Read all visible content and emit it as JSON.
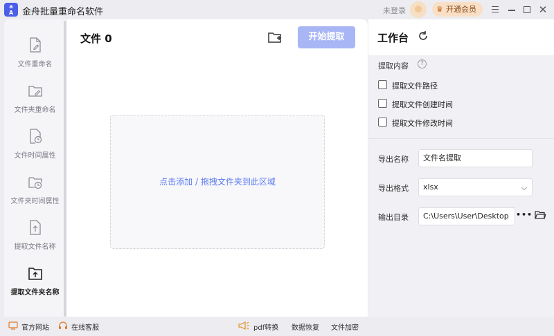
{
  "app": {
    "title": "金舟批量重命名软件",
    "logo_text": "A",
    "login_text": "未登录",
    "vip_label": "开通会员"
  },
  "sidebar": {
    "items": [
      {
        "label": "文件重命名",
        "icon": "file-edit-icon"
      },
      {
        "label": "文件夹重命名",
        "icon": "folder-edit-icon"
      },
      {
        "label": "文件时间属性",
        "icon": "file-clock-icon"
      },
      {
        "label": "文件夹时间属性",
        "icon": "folder-clock-icon"
      },
      {
        "label": "提取文件名称",
        "icon": "file-upload-icon"
      },
      {
        "label": "提取文件夹名称",
        "icon": "folder-upload-icon",
        "active": true
      }
    ]
  },
  "main": {
    "title": "文件 0",
    "extract_button": "开始提取",
    "dropzone": {
      "add_text": "点击添加",
      "separator": " / ",
      "drag_text": "拖拽文件夹到此区域"
    }
  },
  "workspace": {
    "title": "工作台",
    "content_label": "提取内容",
    "options": [
      {
        "label": "提取文件路径",
        "checked": false
      },
      {
        "label": "提取文件创建时间",
        "checked": false
      },
      {
        "label": "提取文件修改时间",
        "checked": false
      }
    ],
    "export_name_label": "导出名称",
    "export_name_value": "文件名提取",
    "export_format_label": "导出格式",
    "export_format_value": "xlsx",
    "output_dir_label": "输出目录",
    "output_dir_value": "C:\\Users\\User\\Desktop",
    "browse_label": "•••"
  },
  "bottom": {
    "website": "官方网站",
    "support": "在线客服",
    "pdf": "pdf转换",
    "recovery": "数据恢复",
    "encrypt": "文件加密"
  },
  "colors": {
    "accent": "#5b79ef",
    "button_disabled": "#a8b6f6",
    "vip_bg": "#f9dfc6"
  }
}
